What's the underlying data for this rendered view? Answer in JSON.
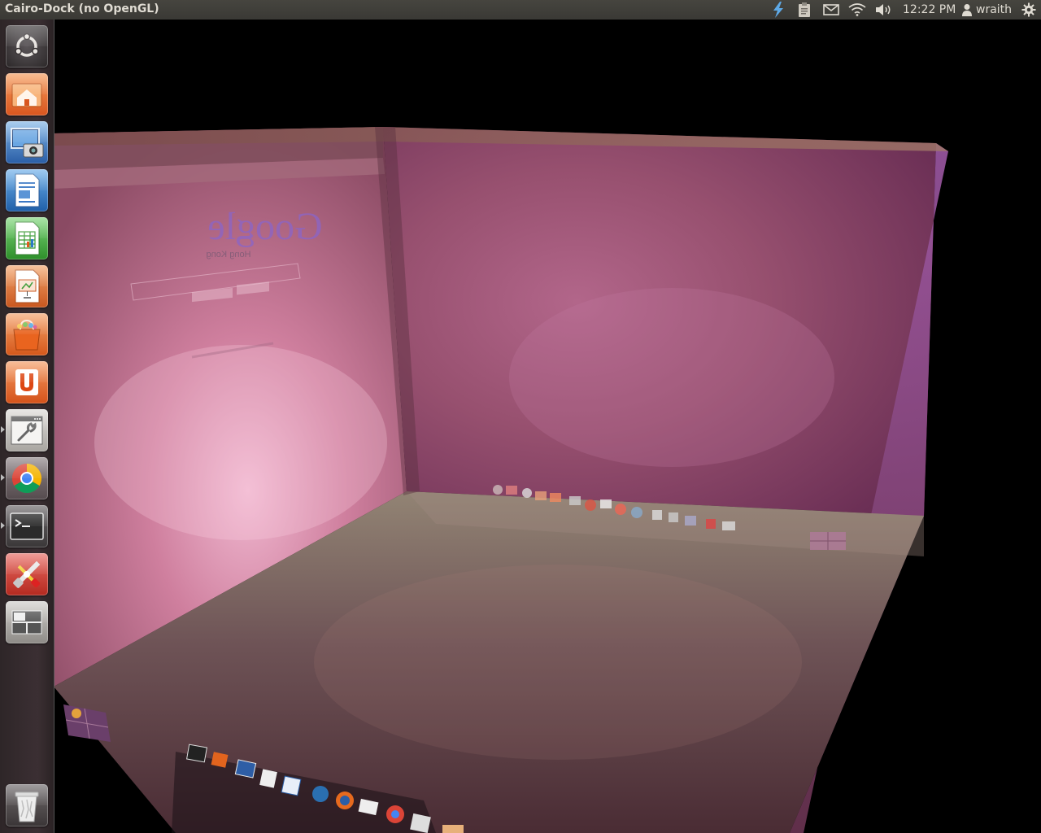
{
  "panel": {
    "title": "Cairo-Dock (no OpenGL)",
    "clock": "12:22 PM",
    "user": "wraith",
    "indicators": [
      "bolt-icon",
      "clipboard-icon",
      "mail-icon",
      "wifi-icon",
      "volume-icon",
      "user-icon",
      "power-gear-icon"
    ]
  },
  "launcher": {
    "items": [
      {
        "name": "ubuntu-dash",
        "icon": "ubuntu-logo-icon"
      },
      {
        "name": "home-folder",
        "icon": "home-folder-icon"
      },
      {
        "name": "screenshot",
        "icon": "screenshot-camera-icon"
      },
      {
        "name": "libreoffice-writer",
        "icon": "writer-document-icon"
      },
      {
        "name": "libreoffice-calc",
        "icon": "calc-spreadsheet-icon"
      },
      {
        "name": "libreoffice-impress",
        "icon": "impress-presentation-icon"
      },
      {
        "name": "ubuntu-software-center",
        "icon": "software-center-bag-icon"
      },
      {
        "name": "ubuntu-one",
        "icon": "ubuntu-one-icon"
      },
      {
        "name": "system-settings-window",
        "icon": "settings-window-icon"
      },
      {
        "name": "google-chrome",
        "icon": "chrome-icon"
      },
      {
        "name": "terminal",
        "icon": "terminal-icon"
      },
      {
        "name": "system-tools",
        "icon": "wrench-screwdriver-icon"
      },
      {
        "name": "workspace-switcher",
        "icon": "workspaces-icon"
      },
      {
        "name": "trash",
        "icon": "trash-icon"
      }
    ]
  },
  "cube": {
    "browser_logo": "Google",
    "browser_sublabel": "Hong Kong"
  },
  "colors": {
    "panel_bg": "#3c3b37",
    "launcher_bg": "#33292c",
    "wallpaper_purple": "#8a3a6a",
    "wallpaper_pink": "#d27a9a",
    "floor_tan": "#8d7a70"
  }
}
